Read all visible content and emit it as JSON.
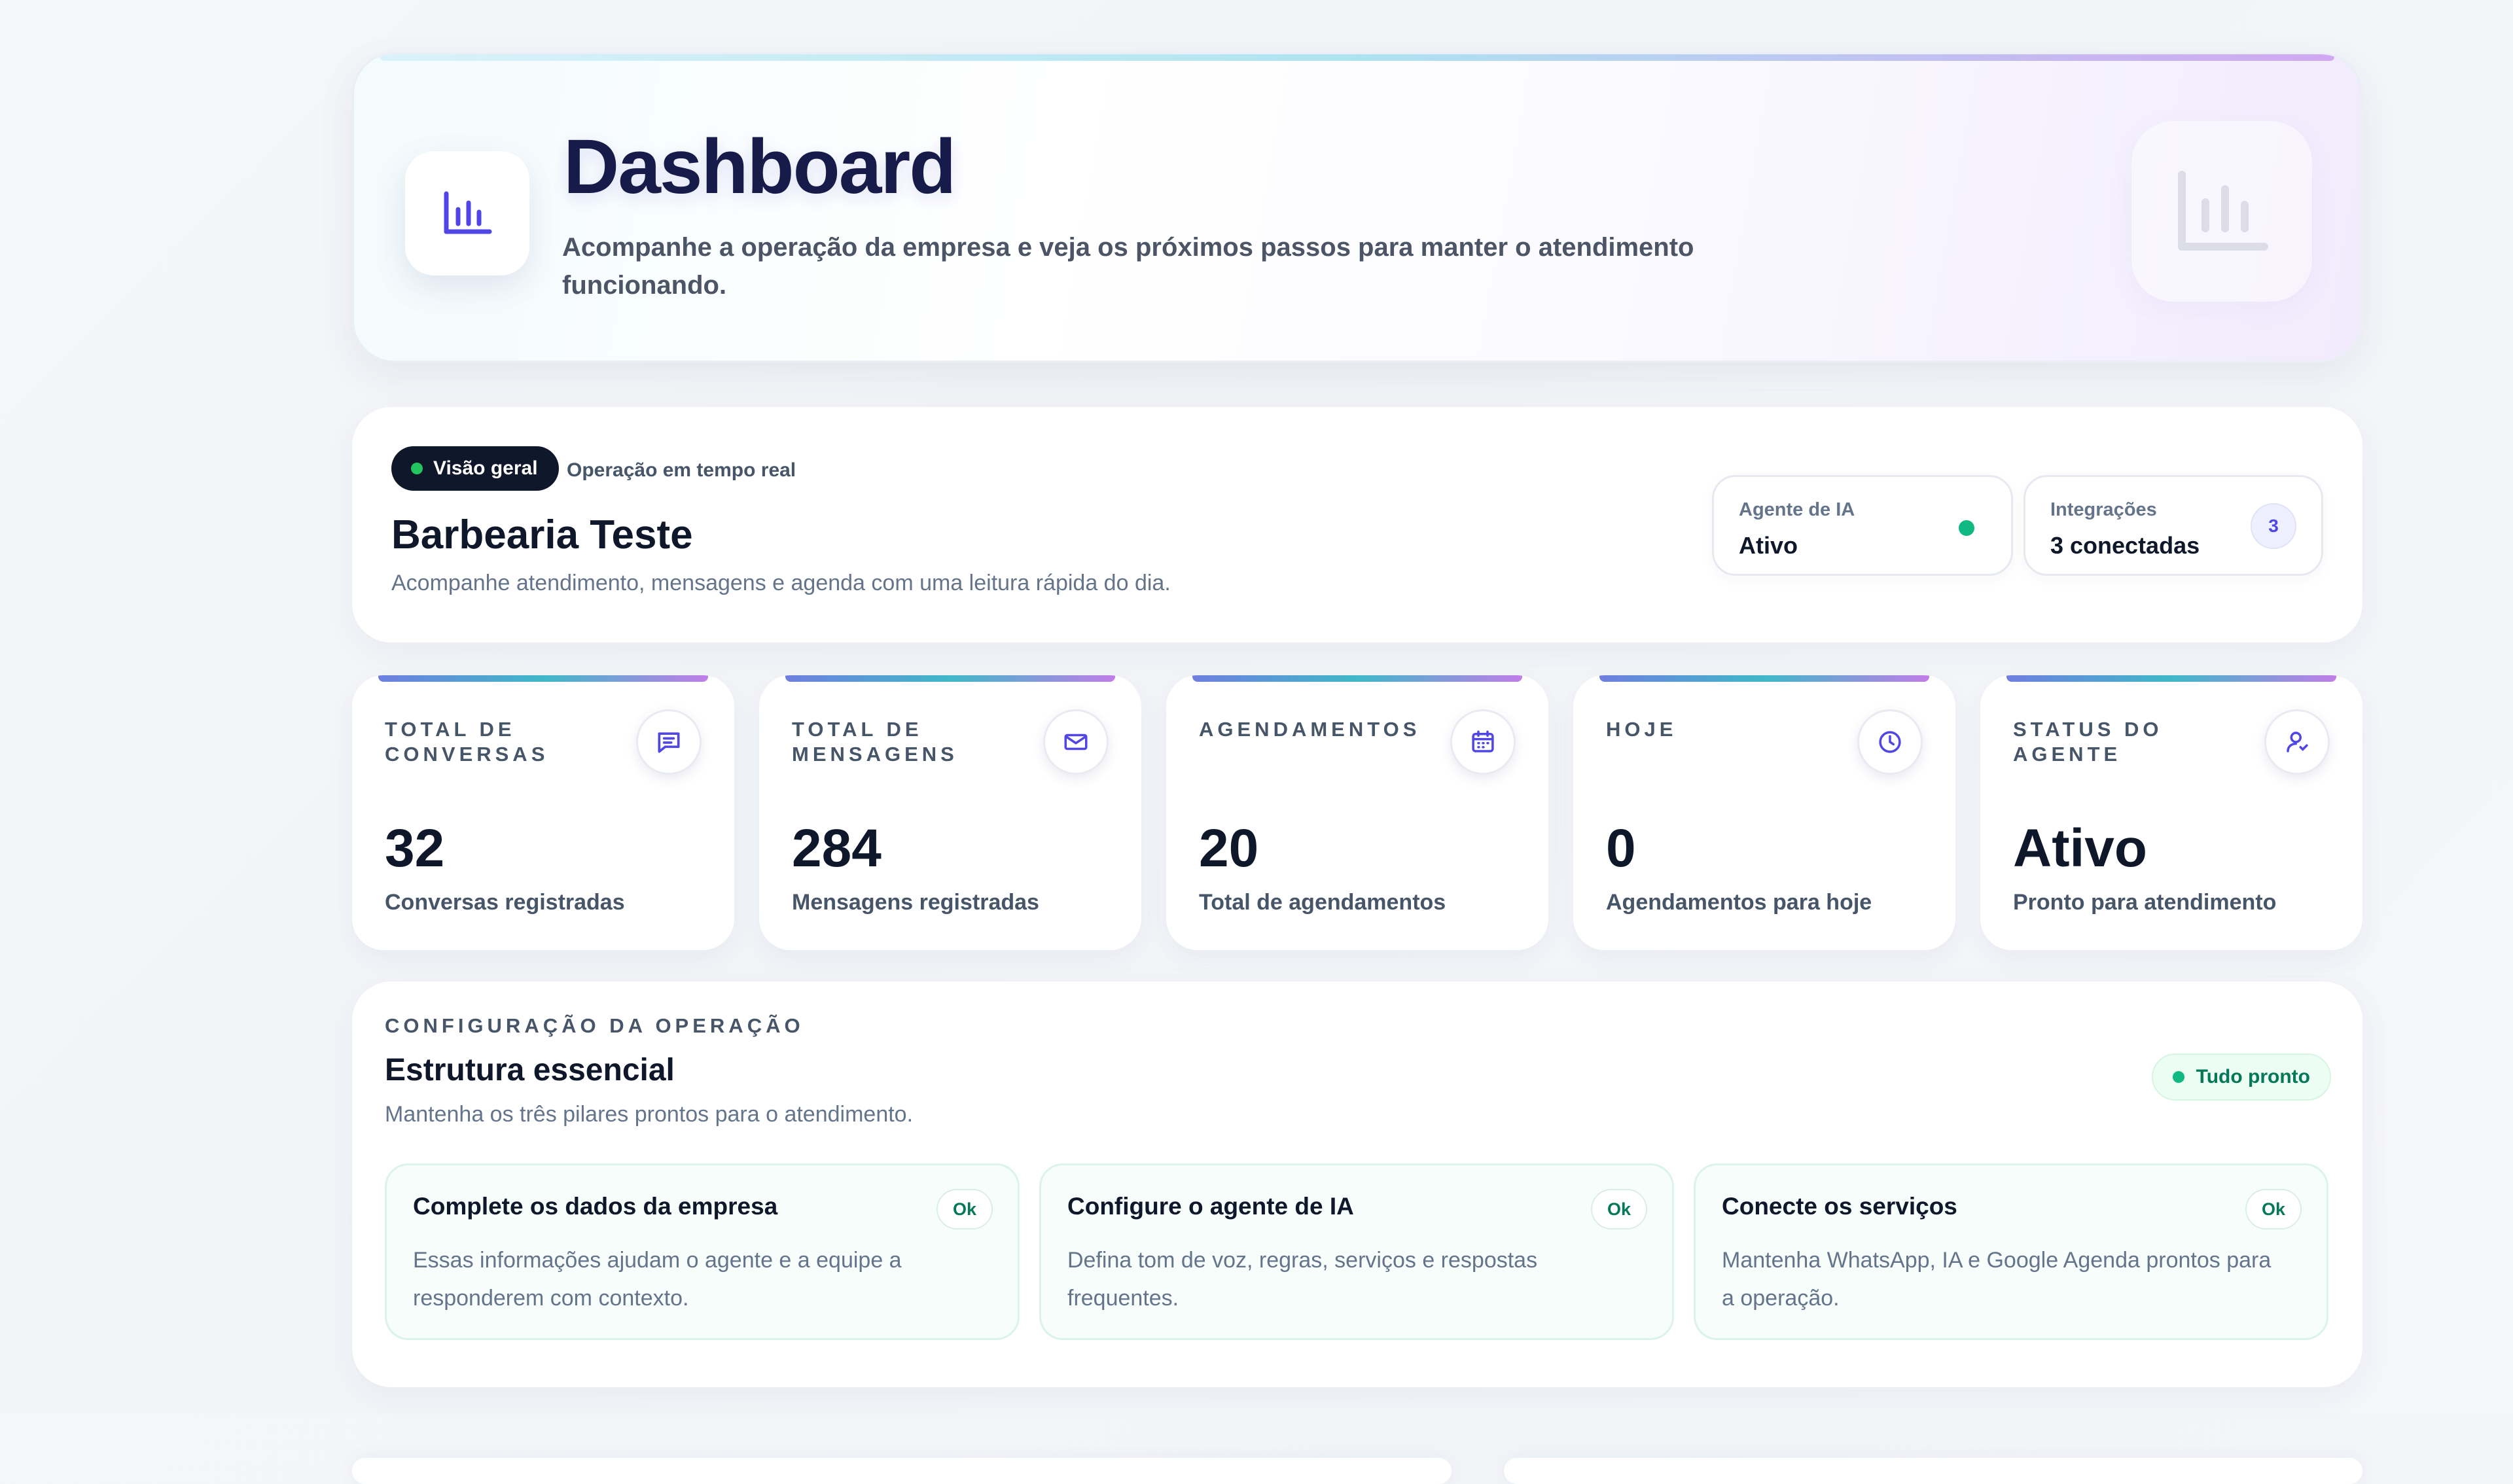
{
  "hero": {
    "title": "Dashboard",
    "subtitle": "Acompanhe a operação da empresa e veja os próximos passos para manter o atendimento funcionando.",
    "icon": "bar-chart-icon"
  },
  "overview": {
    "badge_label": "Visão geral",
    "badge_meta": "Operação em tempo real",
    "company_name": "Barbearia Teste",
    "description": "Acompanhe atendimento, mensagens e agenda com uma leitura rápida do dia.",
    "agent": {
      "label": "Agente de IA",
      "value": "Ativo",
      "status_color": "#10b981"
    },
    "integrations": {
      "label": "Integrações",
      "value": "3 conectadas",
      "count": "3"
    }
  },
  "metrics": [
    {
      "label": "TOTAL DE CONVERSAS",
      "value": "32",
      "description": "Conversas registradas",
      "icon": "chat-icon"
    },
    {
      "label": "TOTAL DE MENSAGENS",
      "value": "284",
      "description": "Mensagens registradas",
      "icon": "mail-icon"
    },
    {
      "label": "AGENDAMENTOS",
      "value": "20",
      "description": "Total de agendamentos",
      "icon": "calendar-icon"
    },
    {
      "label": "HOJE",
      "value": "0",
      "description": "Agendamentos para hoje",
      "icon": "clock-icon"
    },
    {
      "label": "STATUS DO AGENTE",
      "value": "Ativo",
      "description": "Pronto para atendimento",
      "icon": "user-icon"
    }
  ],
  "config": {
    "eyebrow": "CONFIGURAÇÃO DA OPERAÇÃO",
    "title": "Estrutura essencial",
    "subtitle": "Mantenha os três pilares prontos para o atendimento.",
    "status": "Tudo pronto",
    "tasks": [
      {
        "title": "Complete os dados da empresa",
        "description": "Essas informações ajudam o agente e a equipe a responderem com contexto.",
        "status": "Ok"
      },
      {
        "title": "Configure o agente de IA",
        "description": "Defina tom de voz, regras, serviços e respostas frequentes.",
        "status": "Ok"
      },
      {
        "title": "Conecte os serviços",
        "description": "Mantenha WhatsApp, IA e Google Agenda prontos para a operação.",
        "status": "Ok"
      }
    ]
  },
  "colors": {
    "accent": "#4f46e5",
    "dark": "#0f172a",
    "success": "#10b981"
  }
}
